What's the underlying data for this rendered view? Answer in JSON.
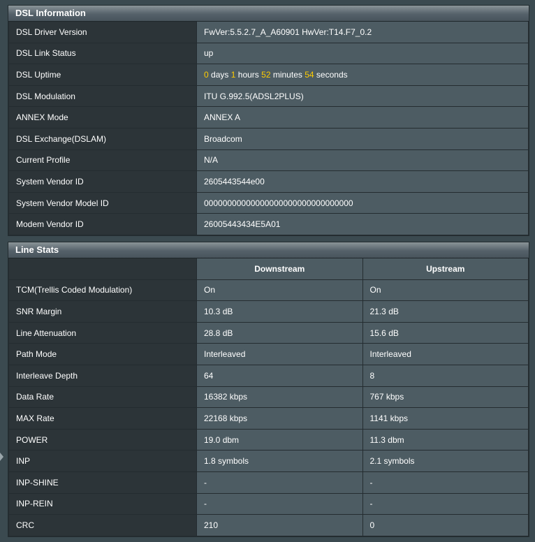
{
  "dsl_info": {
    "title": "DSL Information",
    "driver_version": {
      "label": "DSL Driver Version",
      "value": "FwVer:5.5.2.7_A_A60901 HwVer:T14.F7_0.2"
    },
    "link_status": {
      "label": "DSL Link Status",
      "value": "up"
    },
    "uptime": {
      "label": "DSL Uptime",
      "days": "0",
      "days_unit": "days",
      "hours": "1",
      "hours_unit": "hours",
      "minutes": "52",
      "minutes_unit": "minutes",
      "seconds": "54",
      "seconds_unit": "seconds"
    },
    "modulation": {
      "label": "DSL Modulation",
      "value": "ITU G.992.5(ADSL2PLUS)"
    },
    "annex_mode": {
      "label": "ANNEX Mode",
      "value": "ANNEX A"
    },
    "exchange": {
      "label": "DSL Exchange(DSLAM)",
      "value": "Broadcom"
    },
    "current_profile": {
      "label": "Current Profile",
      "value": "N/A"
    },
    "system_vendor_id": {
      "label": "System Vendor ID",
      "value": "2605443544e00"
    },
    "system_vendor_model_id": {
      "label": "System Vendor Model ID",
      "value": "00000000000000000000000000000000"
    },
    "modem_vendor_id": {
      "label": "Modem Vendor ID",
      "value": "26005443434E5A01"
    }
  },
  "line_stats": {
    "title": "Line Stats",
    "columns": {
      "downstream": "Downstream",
      "upstream": "Upstream"
    },
    "rows": [
      {
        "label": "TCM(Trellis Coded Modulation)",
        "down": "On",
        "up": "On"
      },
      {
        "label": "SNR Margin",
        "down": "10.3 dB",
        "up": "21.3 dB"
      },
      {
        "label": "Line Attenuation",
        "down": "28.8 dB",
        "up": "15.6 dB"
      },
      {
        "label": "Path Mode",
        "down": "Interleaved",
        "up": "Interleaved"
      },
      {
        "label": "Interleave Depth",
        "down": "64",
        "up": "8"
      },
      {
        "label": "Data Rate",
        "down": "16382 kbps",
        "up": "767 kbps"
      },
      {
        "label": "MAX Rate",
        "down": "22168 kbps",
        "up": "1141 kbps"
      },
      {
        "label": "POWER",
        "down": "19.0 dbm",
        "up": "11.3 dbm"
      },
      {
        "label": "INP",
        "down": "1.8 symbols",
        "up": "2.1 symbols"
      },
      {
        "label": "INP-SHINE",
        "down": "-",
        "up": "-"
      },
      {
        "label": "INP-REIN",
        "down": "-",
        "up": "-"
      },
      {
        "label": "CRC",
        "down": "210",
        "up": "0"
      }
    ]
  },
  "colors": {
    "background": "#3b4a50",
    "label_cell": "#2c3438",
    "value_cell": "#4d5c63",
    "uptime_number": "#ffcc00"
  },
  "icons": {
    "side_arrow": "caret-right-icon"
  }
}
